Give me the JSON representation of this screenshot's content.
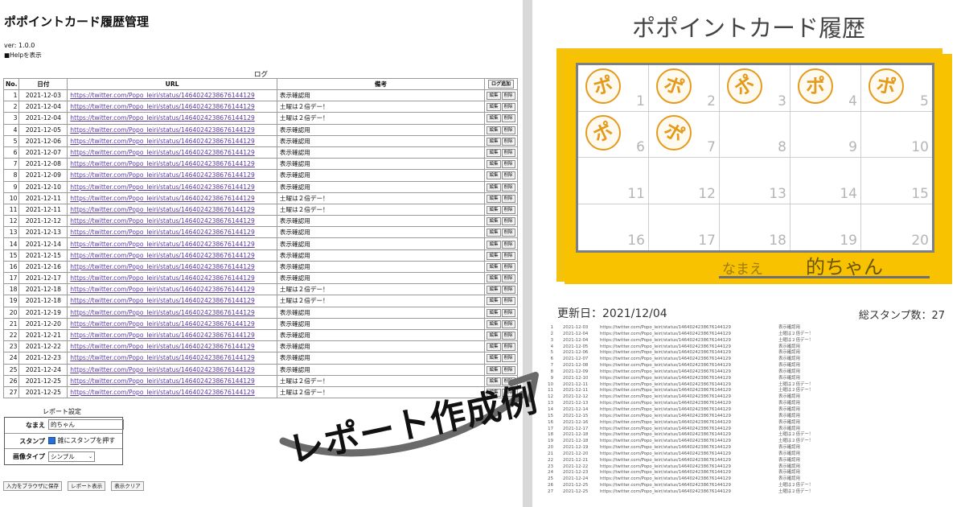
{
  "app": {
    "title": "ポポイントカード履歴管理",
    "version": "ver: 1.0.0",
    "help": "■Helpを表示"
  },
  "log": {
    "caption": "ログ",
    "headers": [
      "No.",
      "日付",
      "URL",
      "備考"
    ],
    "add_button": "ログ追加",
    "edit_button": "編集",
    "delete_button": "削除",
    "rows": [
      {
        "no": "1",
        "date": "2021-12-03",
        "url": "https://twitter.com/Popo_Ieiri/status/1464024238676144129",
        "note": "表示確認用"
      },
      {
        "no": "2",
        "date": "2021-12-04",
        "url": "https://twitter.com/Popo_Ieiri/status/1464024238676144129",
        "note": "土曜は２倍デー！"
      },
      {
        "no": "3",
        "date": "2021-12-04",
        "url": "https://twitter.com/Popo_Ieiri/status/1464024238676144129",
        "note": "土曜は２倍デー！"
      },
      {
        "no": "4",
        "date": "2021-12-05",
        "url": "https://twitter.com/Popo_Ieiri/status/1464024238676144129",
        "note": "表示確認用"
      },
      {
        "no": "5",
        "date": "2021-12-06",
        "url": "https://twitter.com/Popo_Ieiri/status/1464024238676144129",
        "note": "表示確認用"
      },
      {
        "no": "6",
        "date": "2021-12-07",
        "url": "https://twitter.com/Popo_Ieiri/status/1464024238676144129",
        "note": "表示確認用"
      },
      {
        "no": "7",
        "date": "2021-12-08",
        "url": "https://twitter.com/Popo_Ieiri/status/1464024238676144129",
        "note": "表示確認用"
      },
      {
        "no": "8",
        "date": "2021-12-09",
        "url": "https://twitter.com/Popo_Ieiri/status/1464024238676144129",
        "note": "表示確認用"
      },
      {
        "no": "9",
        "date": "2021-12-10",
        "url": "https://twitter.com/Popo_Ieiri/status/1464024238676144129",
        "note": "表示確認用"
      },
      {
        "no": "10",
        "date": "2021-12-11",
        "url": "https://twitter.com/Popo_Ieiri/status/1464024238676144129",
        "note": "土曜は２倍デー！"
      },
      {
        "no": "11",
        "date": "2021-12-11",
        "url": "https://twitter.com/Popo_Ieiri/status/1464024238676144129",
        "note": "土曜は２倍デー！"
      },
      {
        "no": "12",
        "date": "2021-12-12",
        "url": "https://twitter.com/Popo_Ieiri/status/1464024238676144129",
        "note": "表示確認用"
      },
      {
        "no": "13",
        "date": "2021-12-13",
        "url": "https://twitter.com/Popo_Ieiri/status/1464024238676144129",
        "note": "表示確認用"
      },
      {
        "no": "14",
        "date": "2021-12-14",
        "url": "https://twitter.com/Popo_Ieiri/status/1464024238676144129",
        "note": "表示確認用"
      },
      {
        "no": "15",
        "date": "2021-12-15",
        "url": "https://twitter.com/Popo_Ieiri/status/1464024238676144129",
        "note": "表示確認用"
      },
      {
        "no": "16",
        "date": "2021-12-16",
        "url": "https://twitter.com/Popo_Ieiri/status/1464024238676144129",
        "note": "表示確認用"
      },
      {
        "no": "17",
        "date": "2021-12-17",
        "url": "https://twitter.com/Popo_Ieiri/status/1464024238676144129",
        "note": "表示確認用"
      },
      {
        "no": "18",
        "date": "2021-12-18",
        "url": "https://twitter.com/Popo_Ieiri/status/1464024238676144129",
        "note": "土曜は２倍デー！"
      },
      {
        "no": "19",
        "date": "2021-12-18",
        "url": "https://twitter.com/Popo_Ieiri/status/1464024238676144129",
        "note": "土曜は２倍デー！"
      },
      {
        "no": "20",
        "date": "2021-12-19",
        "url": "https://twitter.com/Popo_Ieiri/status/1464024238676144129",
        "note": "表示確認用"
      },
      {
        "no": "21",
        "date": "2021-12-20",
        "url": "https://twitter.com/Popo_Ieiri/status/1464024238676144129",
        "note": "表示確認用"
      },
      {
        "no": "22",
        "date": "2021-12-21",
        "url": "https://twitter.com/Popo_Ieiri/status/1464024238676144129",
        "note": "表示確認用"
      },
      {
        "no": "23",
        "date": "2021-12-22",
        "url": "https://twitter.com/Popo_Ieiri/status/1464024238676144129",
        "note": "表示確認用"
      },
      {
        "no": "24",
        "date": "2021-12-23",
        "url": "https://twitter.com/Popo_Ieiri/status/1464024238676144129",
        "note": "表示確認用"
      },
      {
        "no": "25",
        "date": "2021-12-24",
        "url": "https://twitter.com/Popo_Ieiri/status/1464024238676144129",
        "note": "表示確認用"
      },
      {
        "no": "26",
        "date": "2021-12-25",
        "url": "https://twitter.com/Popo_Ieiri/status/1464024238676144129",
        "note": "土曜は２倍デー！"
      },
      {
        "no": "27",
        "date": "2021-12-25",
        "url": "https://twitter.com/Popo_Ieiri/status/1464024238676144129",
        "note": "土曜は２倍デー！"
      }
    ]
  },
  "report_settings": {
    "caption": "レポート設定",
    "name_label": "なまえ",
    "name_value": "的ちゃん",
    "stamp_label": "スタンプ",
    "stamp_option": "雑にスタンプを押す",
    "stamp_checked": true,
    "image_type_label": "画像タイプ",
    "image_type_value": "シンプル"
  },
  "buttons": {
    "save": "入力をブラウザに保存",
    "report": "レポート表示",
    "clear": "表示クリア"
  },
  "card": {
    "title": "ポポイントカード履歴",
    "name_label": "なまえ",
    "name_value": "的ちゃん",
    "stamp_char": "ポ",
    "cell_numbers": [
      "1",
      "2",
      "3",
      "4",
      "5",
      "6",
      "7",
      "8",
      "9",
      "10",
      "11",
      "12",
      "13",
      "14",
      "15",
      "16",
      "17",
      "18",
      "19",
      "20"
    ],
    "stamped_count": 7,
    "update_date": "更新日：2021/12/04",
    "stamp_total": "総スタンプ数：27",
    "colors": {
      "card": "#f8c200",
      "stamp": "#e59a1b",
      "frame": "#7f7f7f"
    }
  },
  "annotation": {
    "text": "レポート作成例",
    "icon": "curved-arrow-icon"
  }
}
